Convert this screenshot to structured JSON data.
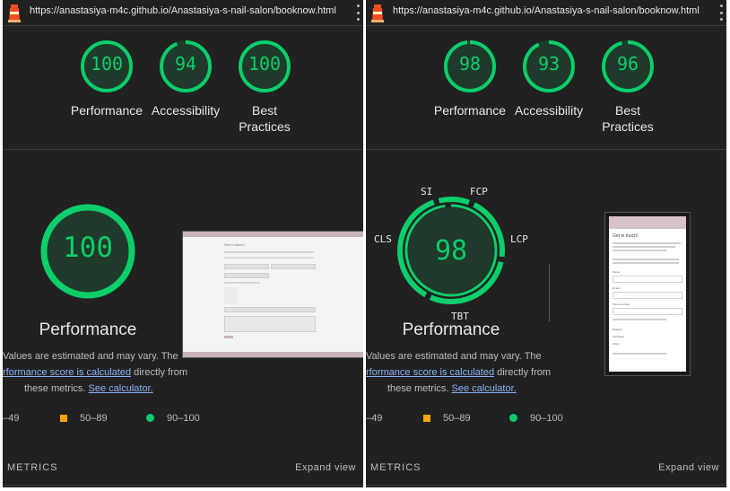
{
  "colors": {
    "pass_green": "#0cce6b",
    "average_orange": "#ffa400",
    "link_blue": "#8ab4f8",
    "panel_bg": "#212121"
  },
  "left": {
    "url": "https://anastasiya-m4c.github.io/Anastasiya-s-nail-salon/booknow.html",
    "scores": [
      {
        "value": "100",
        "label": "Performance",
        "fraction": 1.0
      },
      {
        "value": "94",
        "label": "Accessibility",
        "fraction": 0.94
      },
      {
        "value": "100",
        "label_line1": "Best",
        "label_line2": "Practices",
        "fraction": 1.0
      }
    ],
    "performance": {
      "score": "100",
      "title": "Performance"
    },
    "desc_line1": "Values are estimated and may vary. The",
    "desc_link1": "rformance score is calculated",
    "desc_mid": " directly from",
    "desc_line3_pre": "these metrics. ",
    "desc_link2": "See calculator.",
    "legend": {
      "fail": "–49",
      "average": "50–89",
      "pass": "90–100"
    },
    "metrics_label": "METRICS",
    "expand_label": "Expand view",
    "thumbnail": {
      "title": "Get in touch!"
    }
  },
  "right": {
    "url": "https://anastasiya-m4c.github.io/Anastasiya-s-nail-salon/booknow.html",
    "scores": [
      {
        "value": "98",
        "label": "Performance",
        "fraction": 0.98
      },
      {
        "value": "93",
        "label": "Accessibility",
        "fraction": 0.93
      },
      {
        "value": "96",
        "label_line1": "Best",
        "label_line2": "Practices",
        "fraction": 0.96
      }
    ],
    "performance": {
      "score": "98",
      "title": "Performance",
      "metrics": {
        "si": "SI",
        "fcp": "FCP",
        "lcp": "LCP",
        "tbt": "TBT",
        "cls": "CLS"
      }
    },
    "desc_line1": "Values are estimated and may vary. The",
    "desc_link1": "rformance score is calculated",
    "desc_mid": " directly from",
    "desc_line3_pre": "these metrics. ",
    "desc_link2": "See calculator.",
    "legend": {
      "fail": "–49",
      "average": "50–89",
      "pass": "90–100"
    },
    "metrics_label": "METRICS",
    "expand_label": "Expand view",
    "thumbnail": {
      "title": "Get in touch!",
      "fields": [
        "Name",
        "Email",
        "Phone number"
      ],
      "options": [
        "Booking",
        "Feedback",
        "Other"
      ]
    }
  }
}
